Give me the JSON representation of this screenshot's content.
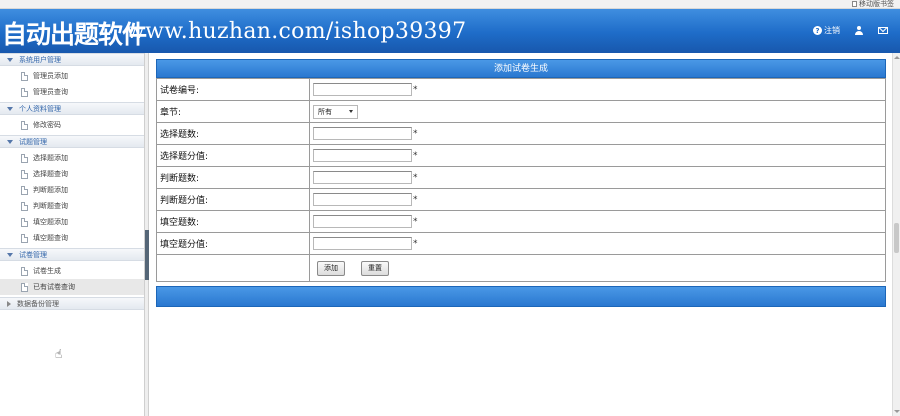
{
  "top_strip": {
    "bookmark_label": "移动版书签"
  },
  "header": {
    "brand": "自动出题软件",
    "url_overlay": "www.huzhan.com/ishop39397",
    "logout_label": "注销"
  },
  "sidebar": {
    "groups": [
      {
        "label": "系统用户管理",
        "expanded": true,
        "items": [
          {
            "label": "管理员添加"
          },
          {
            "label": "管理员查询"
          }
        ]
      },
      {
        "label": "个人资料管理",
        "expanded": true,
        "items": [
          {
            "label": "修改密码"
          }
        ]
      },
      {
        "label": "试题管理",
        "expanded": true,
        "items": [
          {
            "label": "选择题添加"
          },
          {
            "label": "选择题查询"
          },
          {
            "label": "判断题添加"
          },
          {
            "label": "判断题查询"
          },
          {
            "label": "填空题添加"
          },
          {
            "label": "填空题查询"
          }
        ]
      },
      {
        "label": "试卷管理",
        "expanded": true,
        "items": [
          {
            "label": "试卷生成"
          },
          {
            "label": "已有试卷查询",
            "active": true
          }
        ]
      },
      {
        "label": "数据备份管理",
        "expanded": false,
        "items": []
      }
    ]
  },
  "form": {
    "title": "添加试卷生成",
    "required_mark": "*",
    "fields": [
      {
        "label": "试卷编号:",
        "value": "",
        "required": true
      },
      {
        "label": "章节:",
        "type": "select",
        "selected": "所有"
      },
      {
        "label": "选择题数:",
        "value": "",
        "required": true
      },
      {
        "label": "选择题分值:",
        "value": "",
        "required": true
      },
      {
        "label": "判断题数:",
        "value": "",
        "required": true
      },
      {
        "label": "判断题分值:",
        "value": "",
        "required": true
      },
      {
        "label": "填空题数:",
        "value": "",
        "required": true
      },
      {
        "label": "填空题分值:",
        "value": "",
        "required": true
      }
    ],
    "buttons": {
      "add": "添加",
      "reset": "重置"
    }
  }
}
